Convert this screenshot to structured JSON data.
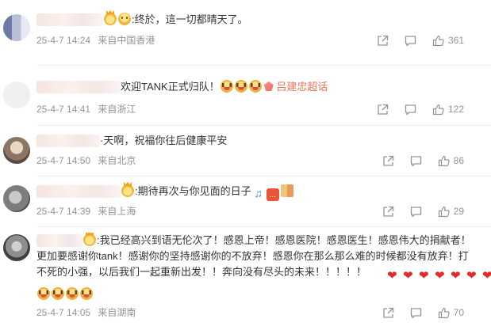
{
  "comments": [
    {
      "text": ":终於，這一切都晴天了。",
      "time": "25-4-7 14:24",
      "location": "来自中国香港",
      "likes": "361"
    },
    {
      "text": "欢迎TANK正式归队！",
      "fan_name": "吕建忠超话",
      "time": "25-4-7 14:41",
      "location": "来自浙江",
      "likes": "122"
    },
    {
      "text": "·天啊，祝福你往后健康平安",
      "time": "25-4-7 14:50",
      "location": "来自北京",
      "likes": "86"
    },
    {
      "text": ":期待再次与你见面的日子",
      "time": "25-4-7 14:39",
      "location": "来自上海",
      "likes": "29"
    },
    {
      "text": ":我已经高兴到语无伦次了！感恩上帝！感恩医院！感恩医生！感恩伟大的捐献者！更加要感谢你tank！感谢你的坚持感谢你的不放弃！感恩你在那么那么难的时候都没有放弃！打不死的小强，以后我们一起重新出发！！奔向没有尽头的未来！！！！！",
      "time": "25-4-7 14:05",
      "location": "来自湖南",
      "likes": "70"
    }
  ],
  "icons": {
    "share": "share-icon",
    "comment": "comment-icon",
    "like": "thumbs-up-icon"
  },
  "colors": {
    "meta": "#939393",
    "accent": "#eb7350",
    "heart": "#e32b2b"
  }
}
